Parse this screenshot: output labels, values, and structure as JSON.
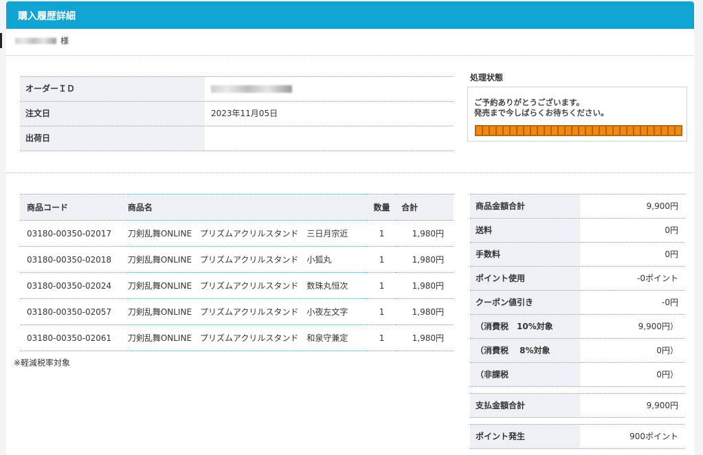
{
  "header": {
    "title": "購入履歴詳細"
  },
  "customer": {
    "suffix": "様"
  },
  "order": {
    "id_label": "オーダーＩＤ",
    "date_label": "注文日",
    "date_value": "2023年11月05日",
    "ship_label": "出荷日",
    "ship_value": ""
  },
  "status": {
    "title": "処理状態",
    "line1": "ご予約ありがとうございます。",
    "line2": "発売まで今しばらくお待ちください。",
    "progress_fraction": 1.0,
    "bar_color": "#ef8a10"
  },
  "items": {
    "headers": {
      "code": "商品コード",
      "name": "商品名",
      "qty": "数量",
      "total": "合計"
    },
    "rows": [
      {
        "code": "03180-00350-02017",
        "name": "刀剣乱舞ONLINE　プリズムアクリルスタンド　三日月宗近",
        "qty": "1",
        "total": "1,980円"
      },
      {
        "code": "03180-00350-02018",
        "name": "刀剣乱舞ONLINE　プリズムアクリルスタンド　小狐丸",
        "qty": "1",
        "total": "1,980円"
      },
      {
        "code": "03180-00350-02024",
        "name": "刀剣乱舞ONLINE　プリズムアクリルスタンド　数珠丸恒次",
        "qty": "1",
        "total": "1,980円"
      },
      {
        "code": "03180-00350-02057",
        "name": "刀剣乱舞ONLINE　プリズムアクリルスタンド　小夜左文字",
        "qty": "1",
        "total": "1,980円"
      },
      {
        "code": "03180-00350-02061",
        "name": "刀剣乱舞ONLINE　プリズムアクリルスタンド　和泉守兼定",
        "qty": "1",
        "total": "1,980円"
      }
    ],
    "note": "※軽減税率対象"
  },
  "summary": {
    "subtotal_label": "商品金額合計",
    "subtotal": "9,900円",
    "shipping_label": "送料",
    "shipping": "0円",
    "fee_label": "手数料",
    "fee": "0円",
    "points_used_label": "ポイント使用",
    "points_used": "-0ポイント",
    "coupon_label": "クーポン値引き",
    "coupon": "-0円",
    "tax10_label": "（消費税　10%対象",
    "tax10": "9,900円）",
    "tax8_label": "（消費税　 8%対象",
    "tax8": "0円）",
    "nontax_label": "（非課税",
    "nontax": "0円）",
    "pay_total_label": "支払金額合計",
    "pay_total": "9,900円",
    "points_earned_label": "ポイント発生",
    "points_earned": "900ポイント"
  },
  "colors": {
    "header": "#0fa4d2",
    "label_bg": "#edf1f5",
    "divider": "#3fb0d6"
  }
}
